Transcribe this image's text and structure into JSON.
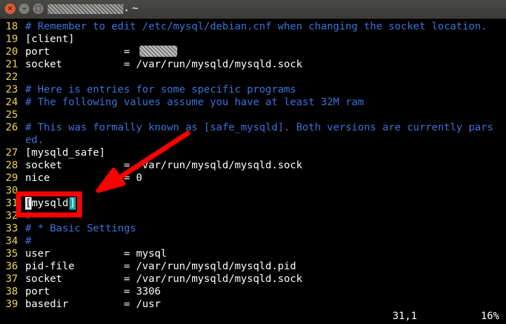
{
  "window": {
    "title_suffix": ". ~",
    "buttons": {
      "close": "×",
      "minimize": "–",
      "maximize": "□"
    }
  },
  "editor": {
    "lines": [
      {
        "n": "18",
        "text": "# Remember to edit /etc/mysql/debian.cnf when changing the socket location.",
        "type": "comment"
      },
      {
        "n": "19",
        "text": "[client]",
        "type": "normal"
      },
      {
        "n": "20",
        "text": "port            = ",
        "type": "normal"
      },
      {
        "n": "21",
        "text": "socket          = /var/run/mysqld/mysqld.sock",
        "type": "normal"
      },
      {
        "n": "22",
        "text": "",
        "type": "normal"
      },
      {
        "n": "23",
        "text": "# Here is entries for some specific programs",
        "type": "comment"
      },
      {
        "n": "24",
        "text": "# The following values assume you have at least 32M ram",
        "type": "comment"
      },
      {
        "n": "25",
        "text": "",
        "type": "normal"
      },
      {
        "n": "26",
        "text": "# This was formally known as [safe_mysqld]. Both versions are currently pars",
        "type": "comment"
      },
      {
        "n": "",
        "text": "ed.",
        "type": "comment"
      },
      {
        "n": "27",
        "text": "[mysqld_safe]",
        "type": "normal"
      },
      {
        "n": "28",
        "text": "socket          = /var/run/mysqld/mysqld.sock",
        "type": "normal"
      },
      {
        "n": "29",
        "text": "nice            = 0",
        "type": "normal"
      },
      {
        "n": "30",
        "text": "",
        "type": "normal"
      },
      {
        "n": "31",
        "text": "mysqld",
        "type": "cursorline"
      },
      {
        "n": "32",
        "text": "#",
        "type": "comment"
      },
      {
        "n": "33",
        "text": "# * Basic Settings",
        "type": "comment"
      },
      {
        "n": "34",
        "text": "#",
        "type": "comment"
      },
      {
        "n": "35",
        "text": "user            = mysql",
        "type": "normal"
      },
      {
        "n": "36",
        "text": "pid-file        = /var/run/mysqld/mysqld.pid",
        "type": "normal"
      },
      {
        "n": "37",
        "text": "socket          = /var/run/mysqld/mysqld.sock",
        "type": "normal"
      },
      {
        "n": "38",
        "text": "port            = 3306",
        "type": "normal"
      },
      {
        "n": "39",
        "text": "basedir         = /usr",
        "type": "normal"
      }
    ],
    "cursor_char": "[",
    "match_char": "]"
  },
  "status": {
    "position": "31,1",
    "percent": "16%"
  },
  "colors": {
    "comment": "#3b73d9",
    "line_number": "#f0d84a",
    "annotation": "#ff0000",
    "match_bracket": "#1aa6a6"
  }
}
